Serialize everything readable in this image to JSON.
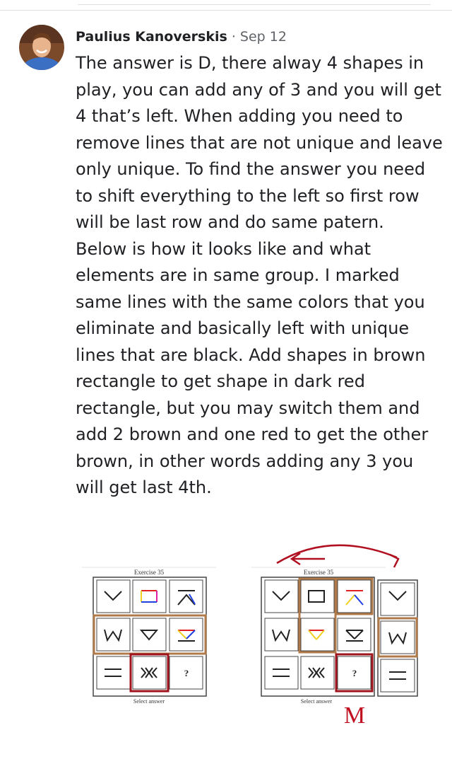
{
  "comment": {
    "author": "Paulius Kanoverskis",
    "separator": "·",
    "date": "Sep 12",
    "lines": [
      "The answer is D, there alway 4 shapes in",
      "play, you can add any of 3 and you will get",
      "4 that’s left. When adding you need to",
      "remove lines that are not unique and leave",
      "only unique. To find the answer you need",
      "to shift everything to the left so first row",
      "will be last row and do same patern.",
      "Below is how it looks like and what",
      "elements are in same group. I marked",
      "same lines with the same colors that you",
      "eliminate and basically left with unique",
      "lines that are black. Add shapes in brown",
      "rectangle to get shape in dark red",
      "rectangle, but you may switch them and",
      "add 2 brown and one red to get the other",
      "brown, in other words adding any 3 you",
      "will get last 4th."
    ]
  },
  "figure1": {
    "title": "Exercise 35",
    "question_mark": "?",
    "footer": "Select answer"
  },
  "figure2": {
    "title": "Exercise 35",
    "question_mark": "?",
    "footer": "Select answer",
    "handwritten_letter": "M"
  },
  "colors": {
    "brown": "#b07a4a",
    "dark_red": "#a0141e",
    "red": "#e02020",
    "blue": "#2040e0",
    "yellow": "#f0d020",
    "magenta": "#e020a0",
    "grid": "#555555"
  }
}
